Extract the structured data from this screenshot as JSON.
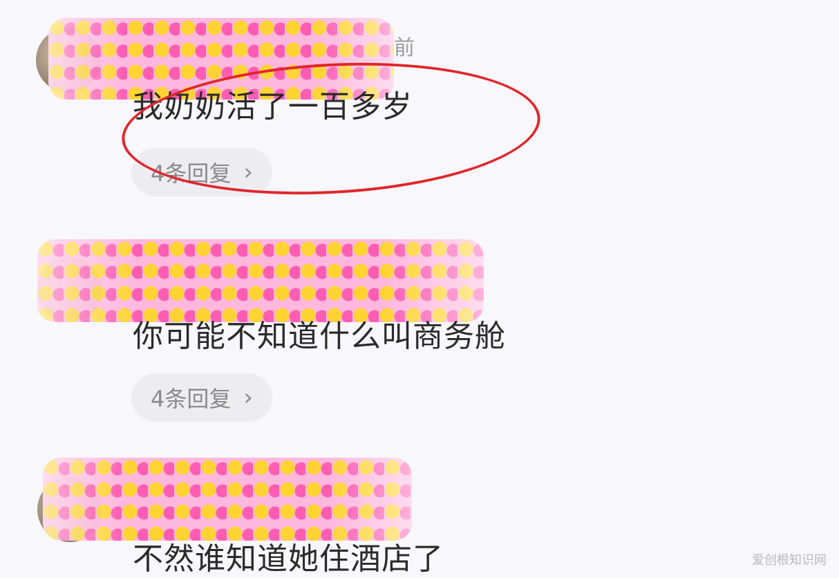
{
  "comments": [
    {
      "partial_time": "前",
      "text": "我奶奶活了一百多岁",
      "reply_label": "4条回复"
    },
    {
      "text": "你可能不知道什么叫商务舱",
      "reply_label": "4条回复"
    },
    {
      "text": "不然谁知道她住酒店了"
    }
  ],
  "icons": {
    "reply_chevron": "chevron-right-icon"
  },
  "colors": {
    "annotation_circle": "#e0262c",
    "emoji_mask": "#ffb9d9"
  },
  "watermark": "爱创根知识网"
}
